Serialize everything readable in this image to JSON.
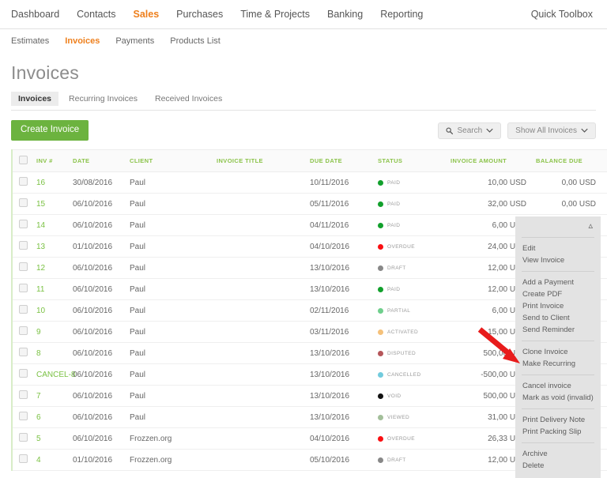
{
  "topnav": {
    "items": [
      {
        "label": "Dashboard",
        "active": false
      },
      {
        "label": "Contacts",
        "active": false
      },
      {
        "label": "Sales",
        "active": true
      },
      {
        "label": "Purchases",
        "active": false
      },
      {
        "label": "Time & Projects",
        "active": false
      },
      {
        "label": "Banking",
        "active": false
      },
      {
        "label": "Reporting",
        "active": false
      }
    ],
    "right_label": "Quick Toolbox"
  },
  "subnav": {
    "items": [
      {
        "label": "Estimates",
        "active": false
      },
      {
        "label": "Invoices",
        "active": true
      },
      {
        "label": "Payments",
        "active": false
      },
      {
        "label": "Products List",
        "active": false
      }
    ]
  },
  "page": {
    "title": "Invoices",
    "tabs": [
      {
        "label": "Invoices",
        "active": true
      },
      {
        "label": "Recurring Invoices",
        "active": false
      },
      {
        "label": "Received Invoices",
        "active": false
      }
    ]
  },
  "actionbar": {
    "create_label": "Create Invoice",
    "search_label": "Search",
    "filter_label": "Show All Invoices",
    "search_icon": "search-icon",
    "chevron_icon": "chevron-down-icon"
  },
  "table": {
    "columns": [
      "INV #",
      "DATE",
      "CLIENT",
      "INVOICE TITLE",
      "DUE DATE",
      "STATUS",
      "INVOICE AMOUNT",
      "BALANCE DUE"
    ],
    "rows": [
      {
        "inv": "16",
        "date": "30/08/2016",
        "client": "Paul",
        "title": "",
        "due": "10/11/2016",
        "status": "PAID",
        "status_color": "#12a02c",
        "amount": "10,00 USD",
        "balance": "0,00 USD",
        "caret": "⌄"
      },
      {
        "inv": "15",
        "date": "06/10/2016",
        "client": "Paul",
        "title": "",
        "due": "05/11/2016",
        "status": "PAID",
        "status_color": "#12a02c",
        "amount": "32,00 USD",
        "balance": "0,00 USD",
        "caret": "⌄"
      },
      {
        "inv": "14",
        "date": "06/10/2016",
        "client": "Paul",
        "title": "",
        "due": "04/11/2016",
        "status": "PAID",
        "status_color": "#12a02c",
        "amount": "6,00 USD",
        "balance": "0,00 USD",
        "caret": "⌄"
      },
      {
        "inv": "13",
        "date": "01/10/2016",
        "client": "Paul",
        "title": "",
        "due": "04/10/2016",
        "status": "OVERDUE",
        "status_color": "#fa0f12",
        "amount": "24,00 USD",
        "balance": "",
        "caret": ""
      },
      {
        "inv": "12",
        "date": "06/10/2016",
        "client": "Paul",
        "title": "",
        "due": "13/10/2016",
        "status": "DRAFT",
        "status_color": "#888888",
        "amount": "12,00 USD",
        "balance": "",
        "caret": ""
      },
      {
        "inv": "11",
        "date": "06/10/2016",
        "client": "Paul",
        "title": "",
        "due": "13/10/2016",
        "status": "PAID",
        "status_color": "#12a02c",
        "amount": "12,00 USD",
        "balance": "",
        "caret": ""
      },
      {
        "inv": "10",
        "date": "06/10/2016",
        "client": "Paul",
        "title": "",
        "due": "02/11/2016",
        "status": "PARTIAL",
        "status_color": "#6fcf8c",
        "amount": "6,00 USD",
        "balance": "",
        "caret": ""
      },
      {
        "inv": "9",
        "date": "06/10/2016",
        "client": "Paul",
        "title": "",
        "due": "03/11/2016",
        "status": "ACTIVATED",
        "status_color": "#f5c17a",
        "amount": "15,00 USD",
        "balance": "",
        "caret": ""
      },
      {
        "inv": "8",
        "date": "06/10/2016",
        "client": "Paul",
        "title": "",
        "due": "13/10/2016",
        "status": "DISPUTED",
        "status_color": "#b5565a",
        "amount": "500,00 USD",
        "balance": "",
        "caret": ""
      },
      {
        "inv": "CANCEL-8",
        "date": "06/10/2016",
        "client": "Paul",
        "title": "",
        "due": "13/10/2016",
        "status": "CANCELLED",
        "status_color": "#72cbdd",
        "amount": "-500,00 USD",
        "balance": "",
        "caret": ""
      },
      {
        "inv": "7",
        "date": "06/10/2016",
        "client": "Paul",
        "title": "",
        "due": "13/10/2016",
        "status": "VOID",
        "status_color": "#111111",
        "amount": "500,00 USD",
        "balance": "",
        "caret": ""
      },
      {
        "inv": "6",
        "date": "06/10/2016",
        "client": "Paul",
        "title": "",
        "due": "13/10/2016",
        "status": "VIEWED",
        "status_color": "#a3bf9a",
        "amount": "31,00 USD",
        "balance": "",
        "caret": ""
      },
      {
        "inv": "5",
        "date": "06/10/2016",
        "client": "Frozzen.org",
        "title": "",
        "due": "04/10/2016",
        "status": "OVERDUE",
        "status_color": "#fa0f12",
        "amount": "26,33 USD",
        "balance": "",
        "caret": ""
      },
      {
        "inv": "4",
        "date": "01/10/2016",
        "client": "Frozzen.org",
        "title": "",
        "due": "05/10/2016",
        "status": "DRAFT",
        "status_color": "#888888",
        "amount": "12,00 USD",
        "balance": "",
        "caret": ""
      }
    ]
  },
  "context_menu": {
    "collapse_icon": "chevron-up-icon",
    "groups": [
      [
        "Edit",
        "View Invoice"
      ],
      [
        "Add a Payment",
        "Create PDF",
        "Print Invoice",
        "Send to Client",
        "Send Reminder"
      ],
      [
        "Clone Invoice",
        "Make Recurring"
      ],
      [
        "Cancel invoice",
        "Mark as void (invalid)"
      ],
      [
        "Print Delivery Note",
        "Print Packing Slip"
      ],
      [
        "Archive",
        "Delete"
      ]
    ]
  },
  "annotation": {
    "arrow_color": "#e81c1c",
    "arrow_name": "red-pointer-arrow"
  }
}
